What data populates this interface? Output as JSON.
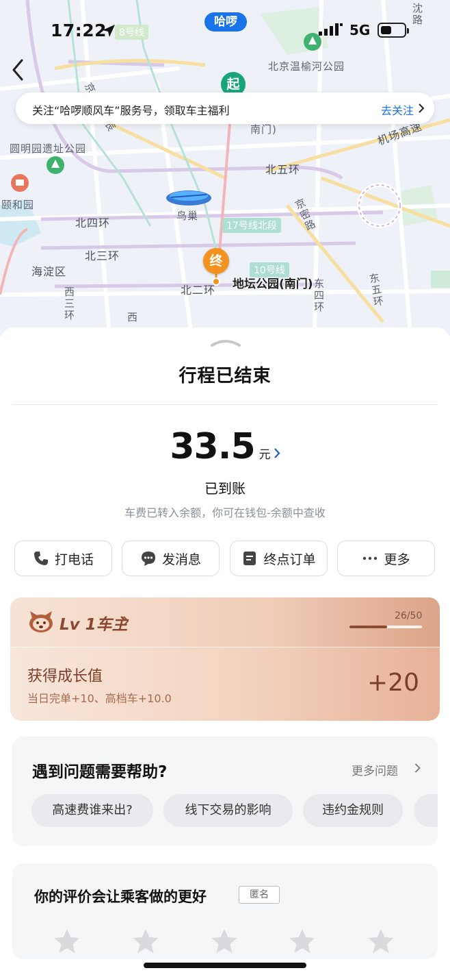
{
  "status_bar": {
    "time": "17:22",
    "carrier_app": "哈啰",
    "network": "5G"
  },
  "map": {
    "labels": {
      "beijing_park": "北京温榆河公园",
      "nanmen_top": "南门)",
      "yuanmingyuan": "圆明园遗址公园",
      "north5": "北五环",
      "airport_hw": "机场高速",
      "yiheyuan": "颐和园",
      "niaochao": "鸟巢",
      "line17": "17号线北段",
      "north4": "北四环",
      "north3": "北三环",
      "haidian": "海淀区",
      "line10": "10号线",
      "north2": "北二环",
      "line8": "8号线",
      "jingmi": "京密路",
      "east5": "东五环",
      "west3": "西三环",
      "east4": "东四环",
      "ditan": "地坛公园(南门)",
      "jing": "京",
      "xi": "西",
      "shun": "沈路",
      "bing": "(辰"
    },
    "start_pin": "起",
    "end_pin": "终"
  },
  "banner": {
    "text": "关注“哈啰顺风车”服务号，领取车主福利",
    "action": "去关注"
  },
  "trip": {
    "title": "行程已结束",
    "amount": "33.5",
    "unit": "元",
    "status": "已到账",
    "note": "车费已转入余额，你可在钱包-余额中查收"
  },
  "actions": [
    {
      "label": "打电话",
      "icon": "phone-icon"
    },
    {
      "label": "发消息",
      "icon": "message-icon"
    },
    {
      "label": "终点订单",
      "icon": "order-icon"
    },
    {
      "label": "更多",
      "icon": "more-icon"
    }
  ],
  "level": {
    "name": "Lv 1车主",
    "progress_text": "26/50",
    "progress": 0.52,
    "growth_title": "获得成长值",
    "growth_detail": "当日完单+10、高档车+10.0",
    "growth_value": "+20"
  },
  "help": {
    "title": "遇到问题需要帮助?",
    "more": "更多问题",
    "chips": [
      "高速费谁来出?",
      "线下交易的影响",
      "违约金规则"
    ]
  },
  "rating": {
    "title": "你的评价会让乘客做的更好",
    "anonymous": "匿名",
    "stars": 5
  },
  "colors": {
    "accent": "#1a73e8",
    "start_pin": "#19a57a",
    "end_pin": "#f49220",
    "level_text": "#7c3e26"
  }
}
